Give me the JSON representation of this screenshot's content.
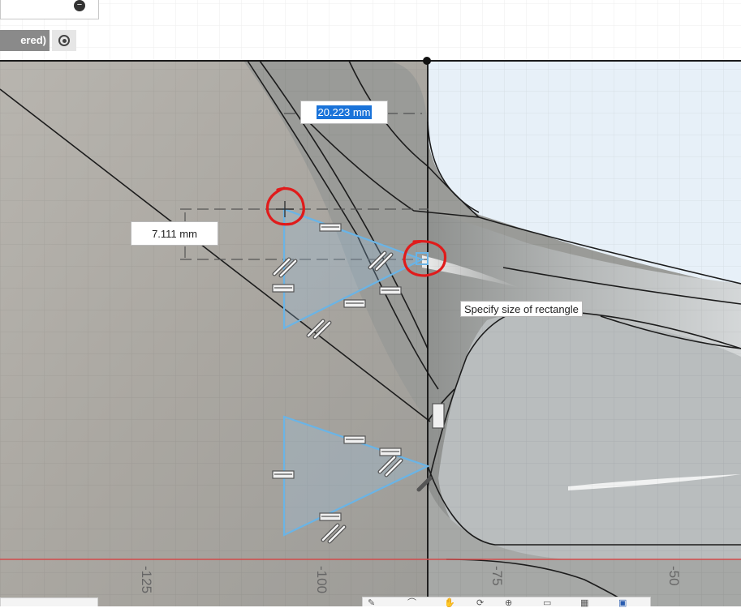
{
  "top_panel": {
    "minus_glyph": "−"
  },
  "sketch_mode": {
    "label": "ered)",
    "radio_selected": true
  },
  "dimension_inputs": {
    "width_value": "20.223 mm",
    "height_value": "7.111 mm"
  },
  "tooltip": {
    "text": "Specify size of rectangle"
  },
  "axis": {
    "labels": [
      "-125",
      "-100",
      "-75",
      "-50"
    ]
  },
  "colors": {
    "sketch_lines": "#6ab4e6",
    "annotation_circles": "#e01b1b",
    "selection_highlight": "#1a73d9",
    "x_axis": "#d24a4a"
  },
  "toolbar": {
    "icons": [
      "pencil-icon",
      "arc-icon",
      "hand-icon",
      "orbit-icon",
      "zoom-icon",
      "display-icon",
      "grid-icon",
      "viewports-icon"
    ]
  }
}
